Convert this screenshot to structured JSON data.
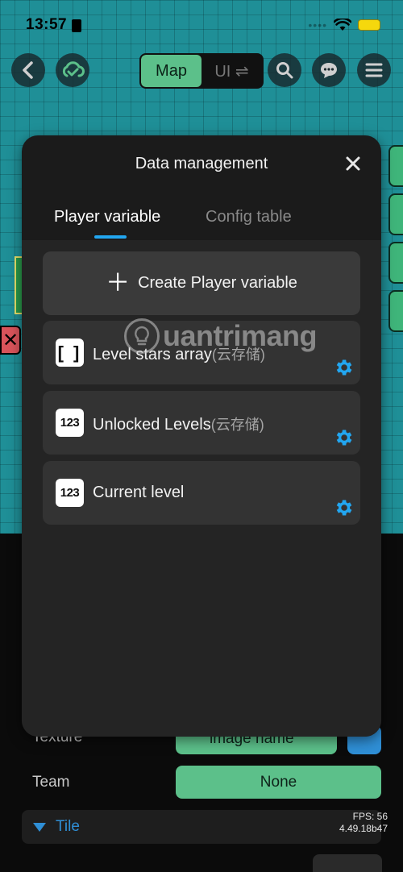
{
  "status_bar": {
    "time": "13:57"
  },
  "toolbar": {
    "segment_map": "Map",
    "segment_ui": "UI ⇌"
  },
  "modal": {
    "title": "Data management",
    "tabs": [
      {
        "label": "Player variable",
        "active": true
      },
      {
        "label": "Config table",
        "active": false
      }
    ],
    "create_label": "Create Player variable",
    "variables": [
      {
        "icon": "[ ]",
        "name": "Level stars array",
        "suffix": "(云存储)"
      },
      {
        "icon": "123",
        "name": "Unlocked Levels",
        "suffix": "(云存储)"
      },
      {
        "icon": "123",
        "name": "Current level",
        "suffix": ""
      }
    ]
  },
  "background_panel": {
    "texture_label": "Texture",
    "texture_value": "image name",
    "team_label": "Team",
    "team_value": "None",
    "tile_section": "Tile",
    "fps": "FPS: 56",
    "version": "4.49.18b47"
  },
  "watermark": {
    "text": "uantrimang"
  },
  "colors": {
    "accent_blue": "#22a6f0",
    "accent_green": "#5cc08a",
    "modal_bg": "#1b1b1b",
    "item_bg": "#333333"
  }
}
